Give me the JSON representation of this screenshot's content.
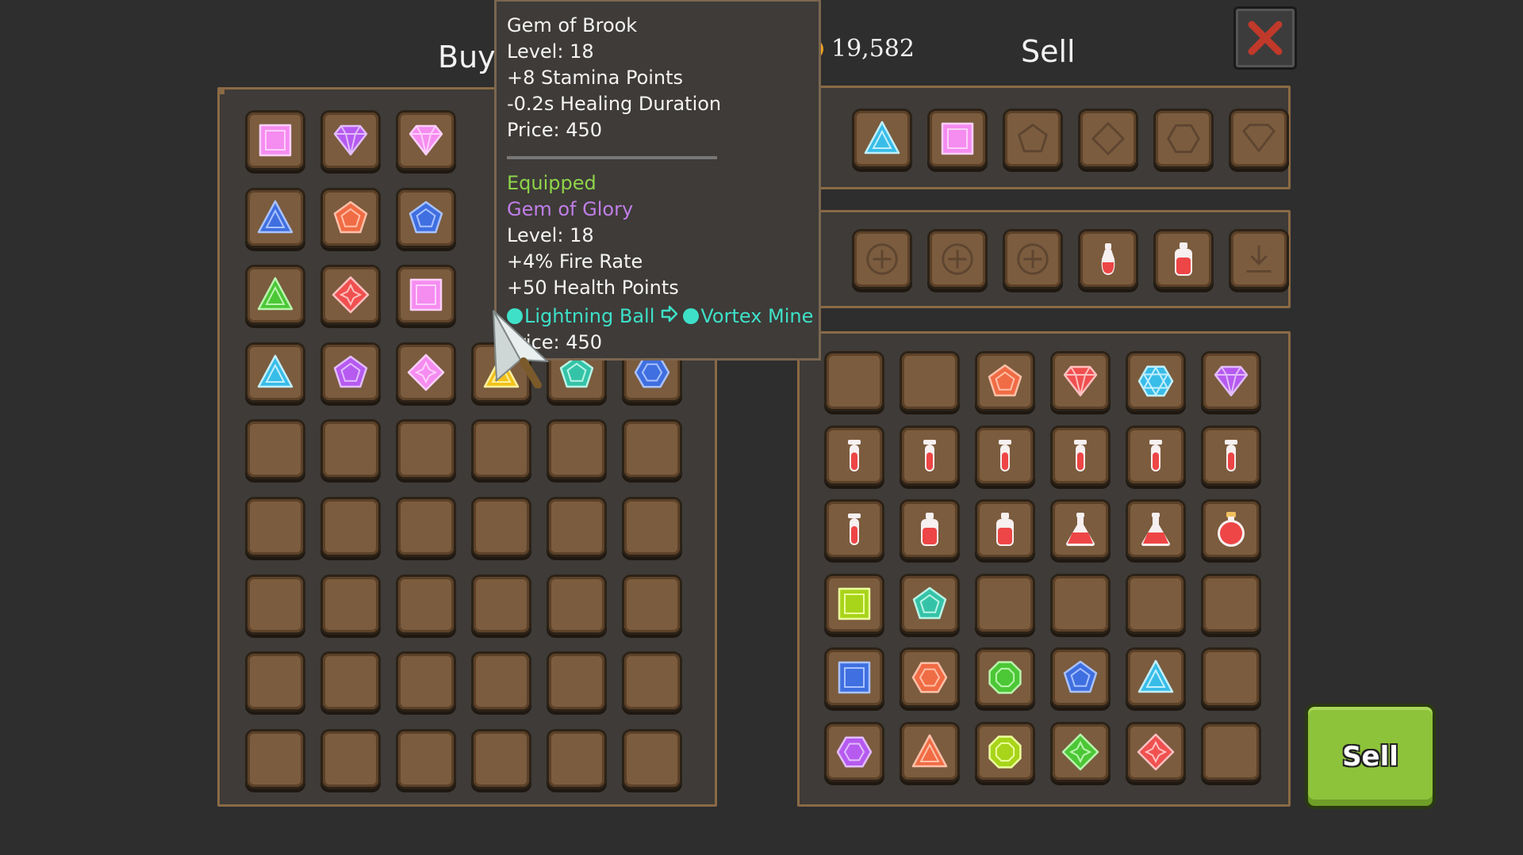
{
  "headers": {
    "buy": "Buy",
    "sell": "Sell"
  },
  "gold": {
    "amount": "19,582",
    "icon": "coin-icon"
  },
  "close_button": {
    "icon": "close-x-icon"
  },
  "tooltip": {
    "hovered": {
      "name": "Gem of Brook",
      "level": "Level: 18",
      "stat1": "+8 Stamina Points",
      "stat2": "-0.2s  Healing Duration",
      "price": "Price: 450"
    },
    "equipped_label": "Equipped",
    "equipped": {
      "name": "Gem of Glory",
      "level": "Level: 18",
      "stat1": "+4% Fire Rate",
      "stat2": "+50 Health Points",
      "skill_from": "Lightning Ball",
      "skill_to": "Vortex Mine",
      "price": "Price: 450"
    }
  },
  "buy_grid": [
    [
      "square-pink",
      "diamond-purple",
      "diamond-pink",
      "hidden",
      "hidden",
      "hidden"
    ],
    [
      "triangle-blue",
      "pentagon-orange",
      "pentagon-blue",
      "hidden",
      "hidden",
      "hidden"
    ],
    [
      "triangle-green",
      "cross-red",
      "square-pink",
      "hidden",
      "hidden",
      "hidden"
    ],
    [
      "triangle-cyan",
      "pentagon-purple",
      "cross-pink",
      "triangle-yellow",
      "pentagon-teal",
      "hexagon-blue"
    ],
    [
      "",
      "",
      "",
      "",
      "",
      ""
    ],
    [
      "",
      "",
      "",
      "",
      "",
      ""
    ],
    [
      "",
      "",
      "",
      "",
      "",
      ""
    ],
    [
      "",
      "",
      "",
      "",
      "",
      ""
    ],
    [
      "",
      "",
      "",
      "",
      "",
      ""
    ]
  ],
  "equip_gems": [
    "hidden",
    "triangle-cyan",
    "square-pink",
    "ghost-pentagon",
    "ghost-diamond",
    "ghost-hexagon",
    "ghost-gem"
  ],
  "equip_potions": [
    "hidden",
    "ghost-plus",
    "ghost-plus",
    "ghost-plus",
    "potion-small",
    "potion-bottle",
    "ghost-download"
  ],
  "sell_grid": [
    [
      "",
      "",
      "pentagon-orange",
      "diamond-red",
      "star-cyan",
      "diamond-purple"
    ],
    [
      "vial",
      "vial",
      "vial",
      "vial",
      "vial",
      "vial"
    ],
    [
      "vial",
      "potion-bottle",
      "potion-bottle",
      "flask",
      "flask",
      "potion-round"
    ],
    [
      "square-lime",
      "pentagon-teal",
      "",
      "",
      "",
      ""
    ],
    [
      "square-blue",
      "hexagon-orange",
      "octagon-green",
      "pentagon-blue",
      "triangle-cyan",
      ""
    ],
    [
      "hexagon-purple",
      "triangle-orange",
      "octagon-lime",
      "cross-green",
      "cross-red",
      ""
    ]
  ],
  "sell_button": {
    "label": "Sell"
  },
  "colors": {
    "background": "#2e2e2e",
    "panel": "#3e3b38",
    "panel_border": "#8a6a45",
    "slot": "#7b5c3e",
    "equipped_text": "#8ed44a",
    "gem_name_text": "#c07ee8",
    "skill_text": "#3ee0c8",
    "sell_button": "#8dc33a",
    "close_x": "#c0392b"
  }
}
